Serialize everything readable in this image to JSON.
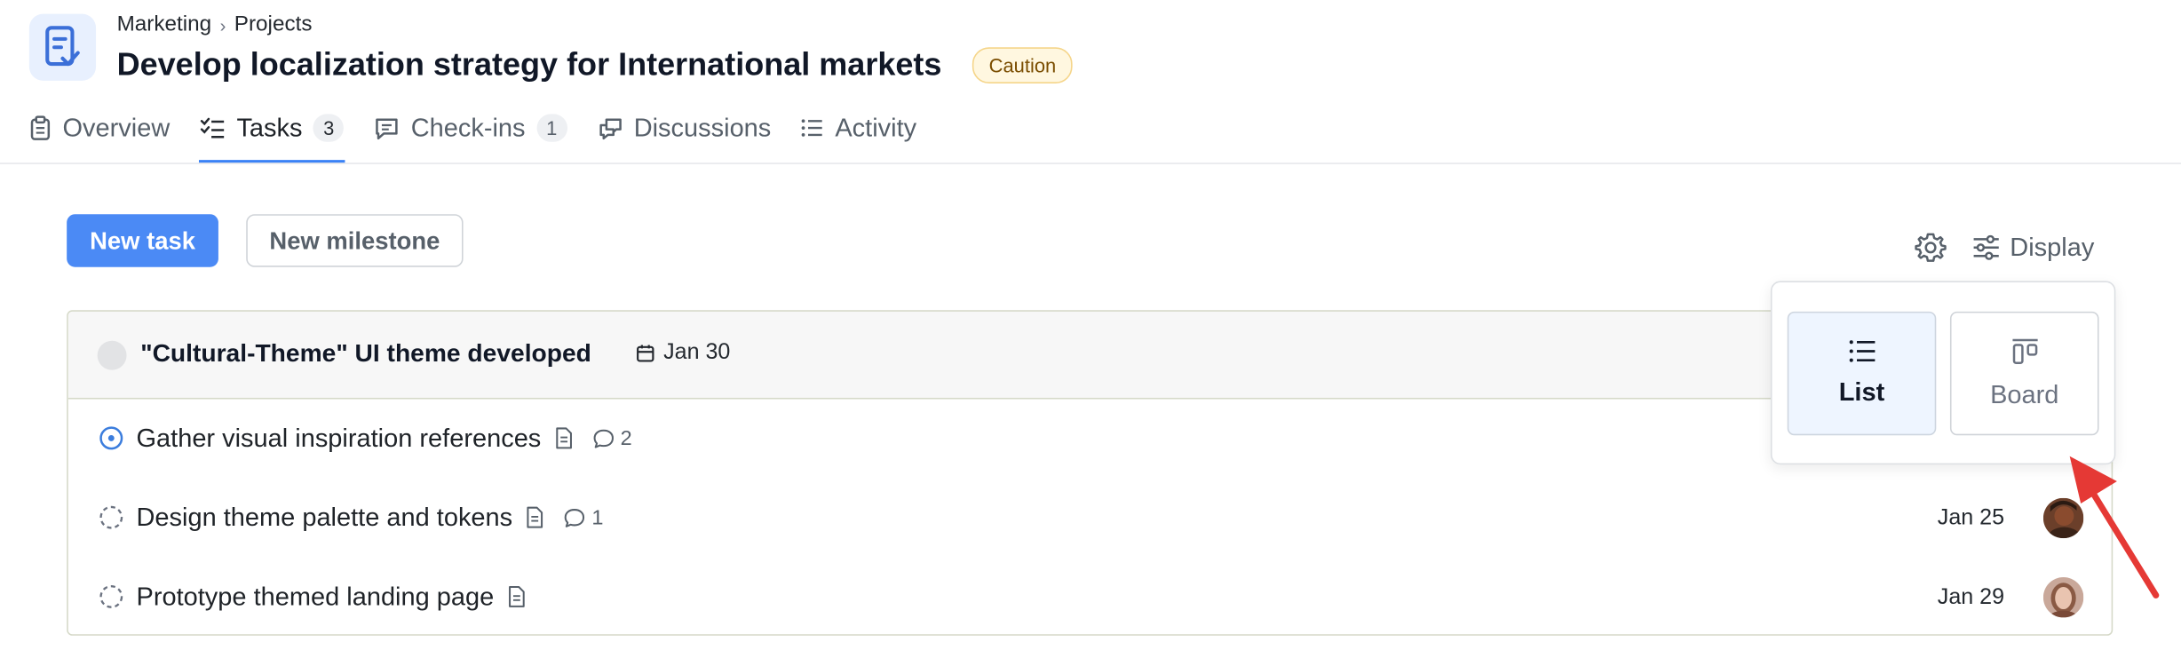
{
  "breadcrumb": {
    "items": [
      "Marketing",
      "Projects"
    ],
    "separator": "›"
  },
  "page": {
    "title": "Develop localization strategy for International markets",
    "status": "Caution"
  },
  "tabs": [
    {
      "label": "Overview",
      "icon": "clipboard-icon",
      "active": false
    },
    {
      "label": "Tasks",
      "icon": "checklist-icon",
      "count": "3",
      "active": true
    },
    {
      "label": "Check-ins",
      "icon": "chat-square-icon",
      "count": "1",
      "active": false
    },
    {
      "label": "Discussions",
      "icon": "discussion-icon",
      "active": false
    },
    {
      "label": "Activity",
      "icon": "activity-list-icon",
      "active": false
    }
  ],
  "toolbar": {
    "new_task": "New task",
    "new_milestone": "New milestone",
    "display": "Display"
  },
  "milestone": {
    "title": "\"Cultural-Theme\" UI theme developed",
    "date": "Jan 30"
  },
  "tasks": [
    {
      "title": "Gather visual inspiration references",
      "status": "in-progress",
      "has_description": true,
      "comments": "2",
      "due": "",
      "avatar": false
    },
    {
      "title": "Design theme palette and tokens",
      "status": "not-started",
      "has_description": true,
      "comments": "1",
      "due": "Jan 25",
      "avatar": true
    },
    {
      "title": "Prototype themed landing page",
      "status": "not-started",
      "has_description": true,
      "comments": "",
      "due": "Jan 29",
      "avatar": true
    }
  ],
  "display_popover": {
    "options": [
      {
        "label": "List",
        "icon": "list-icon",
        "selected": true
      },
      {
        "label": "Board",
        "icon": "board-icon",
        "selected": false
      }
    ]
  },
  "colors": {
    "accent": "#4b8af5",
    "tab_indicator": "#3b82f6",
    "badge_bg": "#fff7e0",
    "badge_border": "#f5d58a",
    "annotation_arrow": "#e53935"
  }
}
